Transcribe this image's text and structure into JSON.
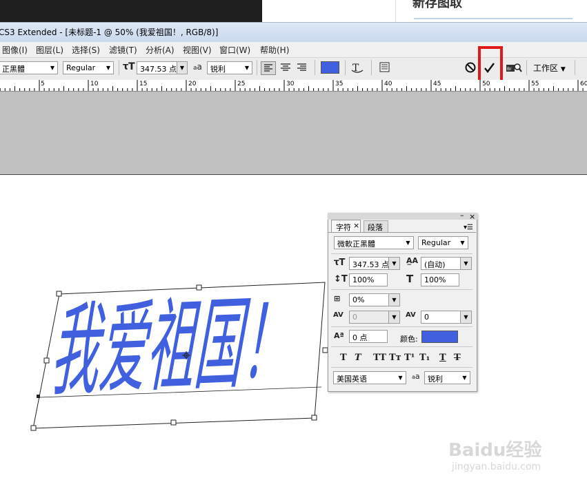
{
  "website": {
    "heading": "新存图取"
  },
  "title_bar": {
    "title": "CS3 Extended - [未标题-1 @ 50% (我爱祖国！, RGB/8)]"
  },
  "menu": {
    "items": [
      "图像(I)",
      "图层(L)",
      "选择(S)",
      "滤镜(T)",
      "分析(A)",
      "视图(V)",
      "窗口(W)",
      "帮助(H)"
    ]
  },
  "options_bar": {
    "font_family": "正黑體",
    "font_style": "Regular",
    "font_size": "347.53 点",
    "antialias_glyph": "a",
    "antialias_value": "锐利",
    "color": "#4060e0",
    "workspace_label": "工作区"
  },
  "ruler": {
    "labels": [
      "5",
      "10",
      "15",
      "20",
      "25",
      "30",
      "35",
      "40",
      "45",
      "50",
      "55",
      "60"
    ]
  },
  "canvas": {
    "text": "我爱祖国！",
    "text_color": "#4060e0"
  },
  "character_panel": {
    "tabs": [
      "字符",
      "段落"
    ],
    "font_family": "微軟正黑體",
    "font_style": "Regular",
    "font_size": "347.53 点",
    "leading": "(自动)",
    "vertical_scale": "100%",
    "horizontal_scale": "100%",
    "tracking_ratio": "0%",
    "kerning": "0",
    "tracking": "0",
    "baseline_shift": "0 点",
    "color_label": "颜色:",
    "color": "#4060e0",
    "style_buttons": [
      "T",
      "T",
      "TT",
      "Tт",
      "T¹",
      "T₁",
      "T",
      "T"
    ],
    "language": "美国英语",
    "antialias_glyph": "a",
    "antialias": "锐利"
  },
  "watermark": {
    "brand": "Baidu经验",
    "url": "jingyan.baidu.com"
  }
}
